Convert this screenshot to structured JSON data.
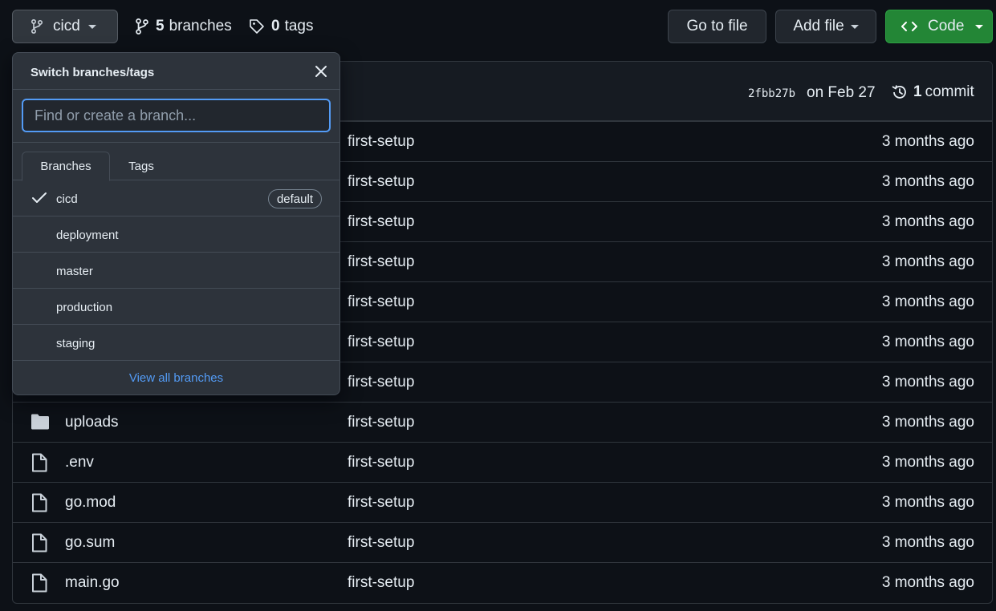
{
  "toolbar": {
    "branch_button": {
      "label": "cicd",
      "icon": "git-branch-icon"
    },
    "branches_link": {
      "count": "5",
      "label": "branches",
      "icon": "git-branch-icon"
    },
    "tags_link": {
      "count": "0",
      "label": "tags",
      "icon": "tag-icon"
    },
    "go_to_file": "Go to file",
    "add_file": "Add file",
    "code": {
      "label": "Code",
      "icon": "code-icon"
    }
  },
  "commit": {
    "sha": "2fbb27b",
    "date": "on Feb 27",
    "count": "1",
    "count_label": "commit"
  },
  "files": [
    {
      "name": "",
      "message": "first-setup",
      "age": "3 months ago",
      "type": "hidden"
    },
    {
      "name": "",
      "message": "first-setup",
      "age": "3 months ago",
      "type": "hidden"
    },
    {
      "name": "",
      "message": "first-setup",
      "age": "3 months ago",
      "type": "hidden"
    },
    {
      "name": "",
      "message": "first-setup",
      "age": "3 months ago",
      "type": "hidden"
    },
    {
      "name": "",
      "message": "first-setup",
      "age": "3 months ago",
      "type": "hidden"
    },
    {
      "name": "",
      "message": "first-setup",
      "age": "3 months ago",
      "type": "hidden"
    },
    {
      "name": "",
      "message": "first-setup",
      "age": "3 months ago",
      "type": "hidden"
    },
    {
      "name": "uploads",
      "message": "first-setup",
      "age": "3 months ago",
      "type": "folder"
    },
    {
      "name": ".env",
      "message": "first-setup",
      "age": "3 months ago",
      "type": "file"
    },
    {
      "name": "go.mod",
      "message": "first-setup",
      "age": "3 months ago",
      "type": "file"
    },
    {
      "name": "go.sum",
      "message": "first-setup",
      "age": "3 months ago",
      "type": "file"
    },
    {
      "name": "main.go",
      "message": "first-setup",
      "age": "3 months ago",
      "type": "file"
    }
  ],
  "dropdown": {
    "title": "Switch branches/tags",
    "search_placeholder": "Find or create a branch...",
    "tabs": [
      "Branches",
      "Tags"
    ],
    "branches": [
      {
        "name": "cicd",
        "selected": true,
        "badge": "default"
      },
      {
        "name": "deployment",
        "selected": false,
        "badge": ""
      },
      {
        "name": "master",
        "selected": false,
        "badge": ""
      },
      {
        "name": "production",
        "selected": false,
        "badge": ""
      },
      {
        "name": "staging",
        "selected": false,
        "badge": ""
      }
    ],
    "view_all": "View all branches"
  },
  "colors": {
    "background": "#0d1117",
    "accent_green": "#238636",
    "link_blue": "#539bf5"
  }
}
